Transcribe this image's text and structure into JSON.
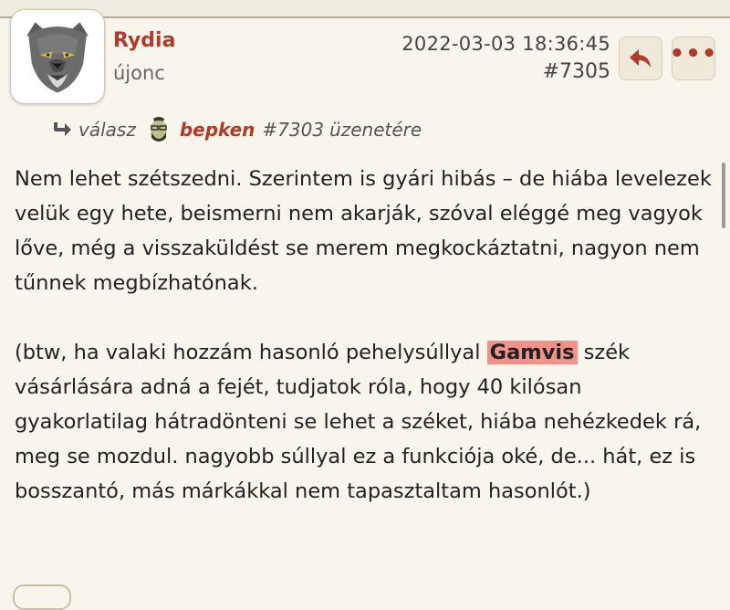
{
  "post": {
    "username": "Rydia",
    "rank": "újonc",
    "date": "2022-03-03 18:36:45",
    "number": "#7305"
  },
  "reply_to": {
    "label": "válasz",
    "user": "bepken",
    "post_number": "#7303",
    "suffix": "üzenetére"
  },
  "body": {
    "paragraph1": "Nem lehet szétszedni. Szerintem is gyári hibás – de hiába levelezek velük egy hete, beismerni nem akarják, szóval eléggé meg vagyok lőve, még a visszaküldést se merem megkockáztatni, nagyon nem tűnnek megbízhatónak.",
    "paragraph2_before": "(btw, ha valaki hozzám hasonló pehelysúllyal",
    "paragraph2_highlight": "Gamvis",
    "paragraph2_after": "szék vásárlására adná a fejét, tudjatok róla, hogy 40 kilósan gyakorlatilag hátradönteni se lehet a széket, hiába nehézkedek rá, meg se mozdul. nagyobb súllyal ez a funkciója oké, de... hát, ez is bosszantó, más márkákkal nem tapasztaltam hasonlót.)"
  },
  "buttons": {
    "more_label": "•••"
  },
  "colors": {
    "accent": "#b23a2a",
    "highlight": "#f2908a",
    "background": "#f7f5ec"
  },
  "icons": {
    "reply": "reply-arrow-icon",
    "reply_to": "reply-arrow-icon",
    "more": "more-dots-icon"
  }
}
